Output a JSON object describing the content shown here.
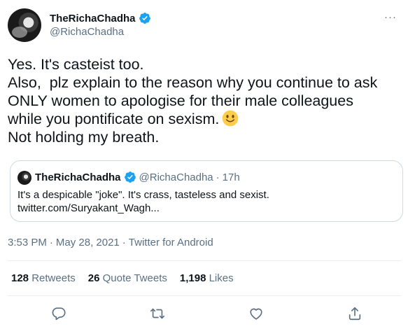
{
  "author": {
    "display_name": "TheRichaChadha",
    "handle": "@RichaChadha"
  },
  "more_icon": "more-icon",
  "tweet": {
    "lines": [
      "Yes. It's casteist too.",
      "Also,  plz explain to the reason why you continue to ask",
      "ONLY women to apologise for their male colleagues",
      "while you pontificate on sexism.",
      "Not holding my breath."
    ],
    "emoji": "slightly-smiling-face"
  },
  "quoted": {
    "display_name": "TheRichaChadha",
    "handle": "@RichaChadha",
    "separator": "·",
    "time": "17h",
    "line1": "It's a despicable \"joke\". It's crass, tasteless and sexist.",
    "line2": "twitter.com/Suryakant_Wagh..."
  },
  "meta": {
    "time": "3:53 PM",
    "sep1": "·",
    "date": "May 28, 2021",
    "sep2": "·",
    "app": "Twitter for Android"
  },
  "stats": {
    "retweets_count": "128",
    "retweets_label": "Retweets",
    "quotes_count": "26",
    "quotes_label": "Quote Tweets",
    "likes_count": "1,198",
    "likes_label": "Likes"
  },
  "colors": {
    "verified": "#1da1f2",
    "secondary_text": "#5b7083",
    "border": "#cfd9de"
  }
}
